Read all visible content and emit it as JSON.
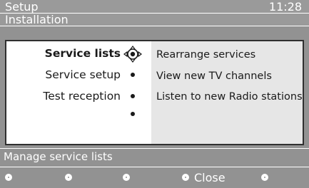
{
  "header": {
    "title": "Setup",
    "clock": "11:28",
    "subtitle": "Installation"
  },
  "menu": {
    "items": [
      {
        "label": "Service lists",
        "active": true
      },
      {
        "label": "Service setup",
        "active": false
      },
      {
        "label": "Test reception",
        "active": false
      },
      {
        "label": "",
        "active": false
      }
    ],
    "options": [
      {
        "label": "Rearrange services"
      },
      {
        "label": "View new TV channels"
      },
      {
        "label": "Listen to new Radio stations"
      }
    ]
  },
  "help": {
    "text": "Manage service lists"
  },
  "keys": [
    {
      "label": ""
    },
    {
      "label": ""
    },
    {
      "label": ""
    },
    {
      "label": "Close"
    },
    {
      "label": ""
    }
  ],
  "colors": {
    "background": "#929292",
    "panel_left": "#ffffff",
    "panel_right": "#e6e6e6",
    "text_dark": "#1a1a1a",
    "text_light": "#ffffff"
  },
  "icons": {
    "cursor": "navigation-cursor-icon",
    "bullet": "bullet-icon",
    "key": "color-key-icon"
  }
}
